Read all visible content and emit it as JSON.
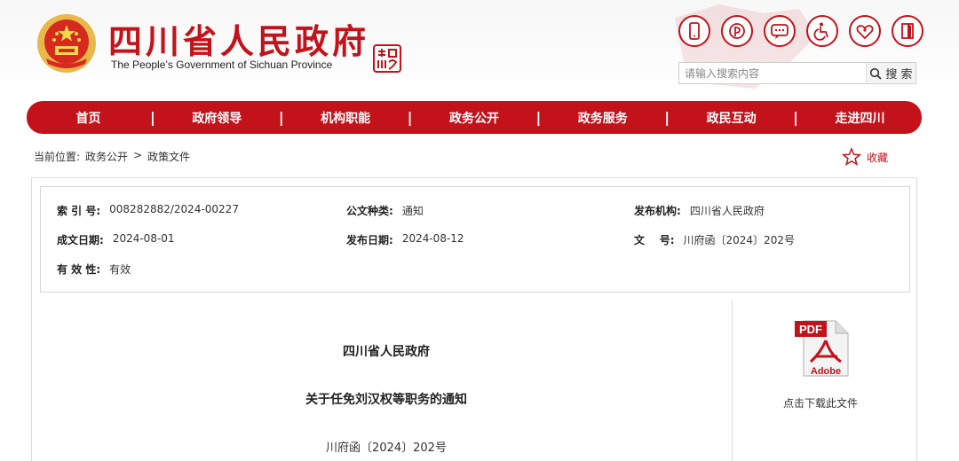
{
  "header": {
    "title_cn": "四川省人民政府",
    "title_en": "The People’s Government of Sichuan Province",
    "seal_text": "中国 四川",
    "top_icons": [
      "mobile-icon",
      "weibo-icon",
      "wechat-icon",
      "accessibility-icon",
      "elderly-care-icon",
      "exit-icon"
    ]
  },
  "search": {
    "placeholder": "请输入搜索内容",
    "button": "搜 索"
  },
  "nav": {
    "items": [
      "首页",
      "政府领导",
      "机构职能",
      "政务公开",
      "政务服务",
      "政民互动",
      "走进四川"
    ]
  },
  "breadcrumb": {
    "prefix": "当前位置:",
    "level1": "政务公开",
    "sep": ">",
    "level2": "政策文件"
  },
  "favorite": {
    "label": "收藏"
  },
  "meta": {
    "index_label": "索 引 号:",
    "index_value": "008282882/2024-00227",
    "type_label": "公文种类:",
    "type_value": "通知",
    "agency_label": "发布机构:",
    "agency_value": "四川省人民政府",
    "created_label": "成文日期:",
    "created_value": "2024-08-01",
    "published_label": "发布日期:",
    "published_value": "2024-08-12",
    "docno_label": "文    号:",
    "docno_value": "川府函〔2024〕202号",
    "validity_label": "有 效 性:",
    "validity_value": "有效"
  },
  "document": {
    "issuer": "四川省人民政府",
    "title": "关于任免刘汉权等职务的通知",
    "number": "川府函〔2024〕202号"
  },
  "download": {
    "pdf_text": "PDF",
    "adobe_text": "Adobe",
    "label": "点击下载此文件"
  },
  "colors": {
    "brand_red": "#c4121a"
  }
}
